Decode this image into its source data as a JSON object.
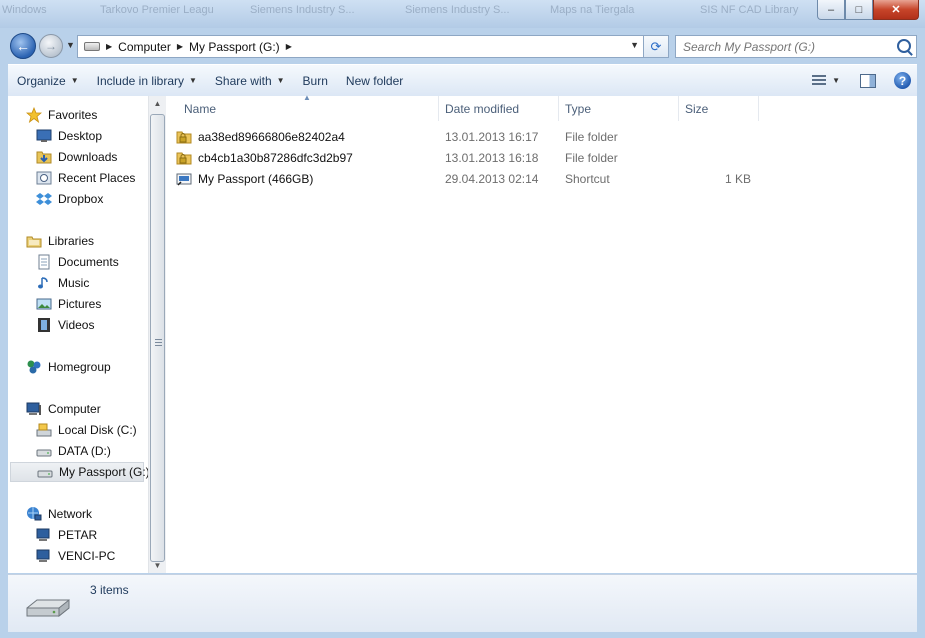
{
  "title_ghost_tabs": [
    "Windows",
    "Tarkovo Premier Leagu",
    "Siemens Industry S...",
    "Siemens Industry S...",
    "Maps na Tiergala",
    "SIS NF CAD Library"
  ],
  "window_controls": {
    "minimize": "–",
    "maximize": "□",
    "close": "✕"
  },
  "address": {
    "crumbs": [
      "Computer",
      "My Passport (G:)"
    ]
  },
  "search": {
    "placeholder": "Search My Passport (G:)"
  },
  "toolbar": {
    "organize": "Organize",
    "include_in_library": "Include in library",
    "share_with": "Share with",
    "burn": "Burn",
    "new_folder": "New folder"
  },
  "nav": {
    "favorites": "Favorites",
    "desktop": "Desktop",
    "downloads": "Downloads",
    "recent_places": "Recent Places",
    "dropbox": "Dropbox",
    "libraries": "Libraries",
    "documents": "Documents",
    "music": "Music",
    "pictures": "Pictures",
    "videos": "Videos",
    "homegroup": "Homegroup",
    "computer": "Computer",
    "local_disk": "Local Disk (C:)",
    "data": "DATA (D:)",
    "my_passport": "My Passport (G:)",
    "network": "Network",
    "petar": "PETAR",
    "venci": "VENCI-PC"
  },
  "columns": {
    "name": "Name",
    "date": "Date modified",
    "type": "Type",
    "size": "Size"
  },
  "files": [
    {
      "name": "aa38ed89666806e82402a4",
      "date": "13.01.2013 16:17",
      "type": "File folder",
      "size": ""
    },
    {
      "name": "cb4cb1a30b87286dfc3d2b97",
      "date": "13.01.2013 16:18",
      "type": "File folder",
      "size": ""
    },
    {
      "name": "My Passport (466GB)",
      "date": "29.04.2013 02:14",
      "type": "Shortcut",
      "size": "1 KB"
    }
  ],
  "status": {
    "item_count": "3 items"
  },
  "colors": {
    "frame": "#b9d1ea",
    "toolbar_text": "#1e395b",
    "accent": "#2b63b2"
  }
}
